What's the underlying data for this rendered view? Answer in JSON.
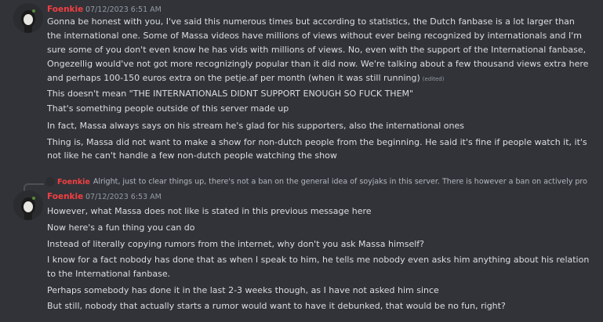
{
  "messages": [
    {
      "author": "Foenkie",
      "timestamp": "07/12/2023 6:51 AM",
      "lines": [
        "Gonna be honest with you, I've said this numerous times but according to statistics, the Dutch fanbase is a lot larger than",
        "the international one. Some of Massa videos have millions of views without ever being recognized by internationals and I'm",
        "sure some of you don't even know he has vids with millions of views. No, even with the support of the International fanbase,",
        "Ongezellig would've not got more recognizingly popular than it did now. We're talking about a few thousand views extra here",
        "and perhaps 100-150 euros extra on the petje.af per month (when it was still running)"
      ],
      "edited_label": "(edited)",
      "followups": [
        "This doesn't mean \"THE INTERNATIONALS DIDNT SUPPORT ENOUGH SO FUCK THEM\"",
        "That's something people outside of this server made up",
        "In fact, Massa always says on his stream he's glad for his supporters, also the international ones",
        "Thing is, Massa did not want to make a show for non-dutch people from the beginning. He said it's fine if people watch it, it's",
        "not like he can't handle a few non-dutch people watching the show"
      ]
    },
    {
      "reply_to": {
        "author": "Foenkie",
        "text": "Alright, just to clear things up, there's not a ban on the general idea of soyjaks in this server. There is however a ban on actively pro"
      },
      "author": "Foenkie",
      "timestamp": "07/12/2023 6:53 AM",
      "lines": [
        "However, what Massa does not like is stated in this previous message here",
        "Now here's a fun thing you can do",
        "Instead of literally copying rumors from the internet, why don't you ask Massa himself?",
        "I know for a fact nobody has done that as when I speak to him, he tells me nobody even asks him anything about his relation",
        "to the International fanbase.",
        "Perhaps somebody has done it in the last 2-3 weeks though, as I have not asked him since",
        "But still, nobody that actually starts a rumor would want to have it debunked, that would be no fun, right?"
      ]
    }
  ],
  "colors": {
    "background": "#313338",
    "author_name": "#f23f42",
    "text": "#dbdee1",
    "muted": "#949ba4"
  },
  "icons": [
    "avatar-image",
    "reply-avatar"
  ]
}
